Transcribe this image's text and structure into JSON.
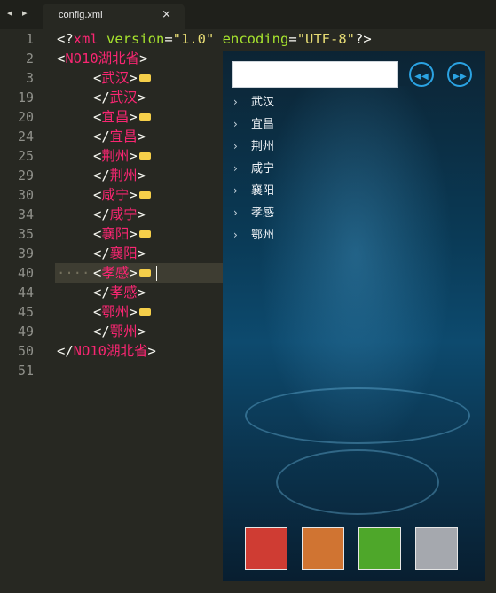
{
  "tabbar": {
    "nav_back_icon": "chevron-left-icon",
    "nav_forward_icon": "chevron-right-icon",
    "nav_text": "◂ ▸"
  },
  "tab": {
    "title": "config.xml",
    "close": "×"
  },
  "gutter": {
    "lines": [
      "1",
      "2",
      "3",
      "19",
      "20",
      "24",
      "25",
      "29",
      "30",
      "34",
      "35",
      "39",
      "40",
      "44",
      "45",
      "49",
      "50",
      "51"
    ]
  },
  "code": {
    "l1": {
      "open": "<?",
      "name": "xml",
      "attr1": " version",
      "eq1": "=",
      "val1": "\"1.0\"",
      "attr2": " encoding",
      "eq2": "=",
      "val2": "\"UTF-8\"",
      "close": "?>"
    },
    "root_open": {
      "lt": "<",
      "name": "NO10湖北省",
      "gt": ">"
    },
    "root_close": {
      "lt": "</",
      "name": "NO10湖北省",
      "gt": ">"
    },
    "cities": [
      "武汉",
      "宜昌",
      "荆州",
      "咸宁",
      "襄阳",
      "孝感",
      "鄂州"
    ],
    "current_line_dots": "····"
  },
  "app": {
    "search_value": "",
    "prev_icon": "fast-rewind-icon",
    "next_icon": "fast-forward-icon",
    "prev_glyph": "◀◀",
    "next_glyph": "▶▶",
    "list": [
      "武汉",
      "宜昌",
      "荆州",
      "咸宁",
      "襄阳",
      "孝感",
      "鄂州"
    ],
    "chevron": "›",
    "swatches": [
      "#cf3c33",
      "#d07432",
      "#4ea72a",
      "#a5a8ae"
    ]
  }
}
